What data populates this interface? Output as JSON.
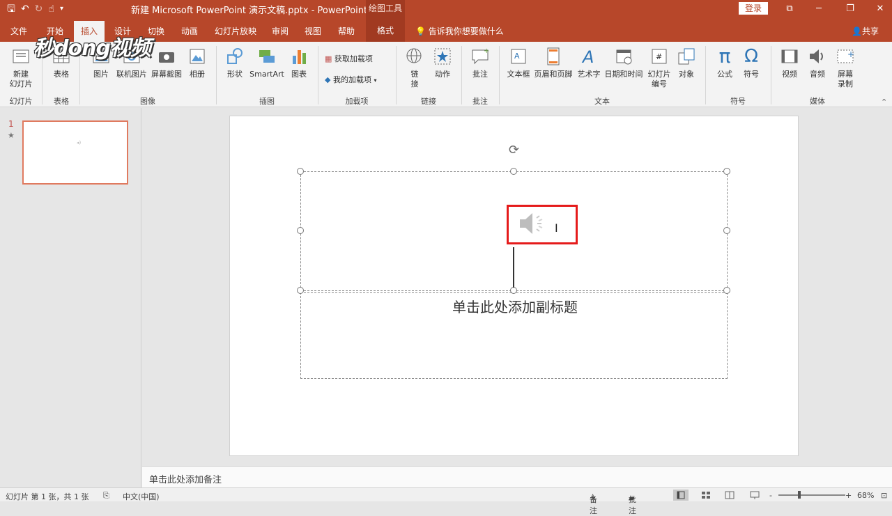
{
  "titlebar": {
    "document_title": "新建 Microsoft PowerPoint 演示文稿.pptx - PowerPoint",
    "context_tools": "绘图工具",
    "login": "登录",
    "qat": {
      "save": "🖫",
      "undo": "↶",
      "redo": "↻",
      "touch": "☝",
      "more": "▾"
    },
    "window_buttons": {
      "ribbon_options": "⧉",
      "minimize": "─",
      "restore": "❐",
      "close": "✕"
    }
  },
  "tabs": {
    "file": "文件",
    "home": "开始",
    "insert": "插入",
    "design": "设计",
    "transitions": "切换",
    "animations": "动画",
    "slideshow": "幻灯片放映",
    "review": "审阅",
    "view": "视图",
    "help": "帮助",
    "format": "格式"
  },
  "tellme": "告诉我你想要做什么",
  "share": "共享",
  "watermark": "秒dong视频",
  "ribbon": {
    "groups": {
      "slides": "幻灯片",
      "tables": "表格",
      "images": "图像",
      "illustrations": "插图",
      "addins": "加载项",
      "links": "链接",
      "comments": "批注",
      "text": "文本",
      "symbols": "符号",
      "media": "媒体"
    },
    "buttons": {
      "new_slide": "新建\n幻灯片",
      "table": "表格",
      "pictures": "图片",
      "online_pictures": "联机图片",
      "screenshot": "屏幕截图",
      "photo_album": "相册",
      "shapes": "形状",
      "smartart": "SmartArt",
      "chart": "图表",
      "get_addins": "获取加载项",
      "my_addins": "我的加载项",
      "link": "链\n接",
      "action": "动作",
      "comment": "批注",
      "textbox": "文本框",
      "header_footer": "页眉和页脚",
      "wordart": "艺术字",
      "datetime": "日期和时间",
      "slide_number": "幻灯片\n编号",
      "object": "对象",
      "equation": "公式",
      "symbol": "符号",
      "video": "视频",
      "audio": "音频",
      "screen_recording": "屏幕\n录制"
    },
    "glyphs": {
      "equation": "π",
      "symbol": "Ω"
    }
  },
  "thumbnails": {
    "number": "1",
    "star": "★"
  },
  "slide": {
    "subtitle_placeholder": "单击此处添加副标题",
    "rotate_glyph": "⟳",
    "cursor": "I"
  },
  "notes": {
    "placeholder": "单击此处添加备注"
  },
  "status": {
    "slide_info": "幻灯片 第 1 张，共 1 张",
    "language": "中文(中国)",
    "notes": "备注",
    "comments": "批注",
    "zoom": "68%",
    "zoom_minus": "-",
    "zoom_plus": "+"
  }
}
